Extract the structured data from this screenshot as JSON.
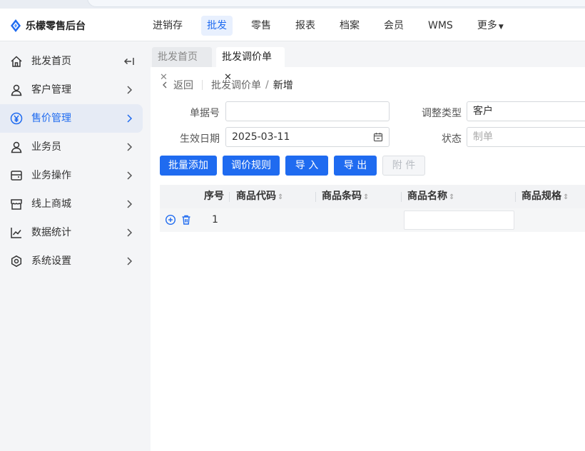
{
  "app": {
    "title": "乐檬零售后台",
    "brand_color": "#1f6bf0"
  },
  "topnav": {
    "items": [
      {
        "label": "进销存",
        "active": false
      },
      {
        "label": "批发",
        "active": true
      },
      {
        "label": "零售",
        "active": false
      },
      {
        "label": "报表",
        "active": false
      },
      {
        "label": "档案",
        "active": false
      },
      {
        "label": "会员",
        "active": false
      },
      {
        "label": "WMS",
        "active": false
      },
      {
        "label": "更多",
        "active": false
      }
    ]
  },
  "sidebar": {
    "items": [
      {
        "label": "批发首页",
        "icon": "home-icon"
      },
      {
        "label": "客户管理",
        "icon": "user-icon"
      },
      {
        "label": "售价管理",
        "icon": "yen-icon",
        "active": true
      },
      {
        "label": "业务员",
        "icon": "user-icon"
      },
      {
        "label": "业务操作",
        "icon": "wallet-icon"
      },
      {
        "label": "线上商城",
        "icon": "store-icon"
      },
      {
        "label": "数据统计",
        "icon": "chart-icon"
      },
      {
        "label": "系统设置",
        "icon": "settings-icon"
      }
    ]
  },
  "tabs": [
    {
      "label": "批发首页",
      "active": false
    },
    {
      "label": "批发调价单",
      "active": true
    }
  ],
  "breadcrumb": {
    "back": "返回",
    "parent": "批发调价单",
    "current": "新增"
  },
  "form": {
    "doc_no_label": "单据号",
    "doc_no_value": "",
    "adjust_type_label": "调整类型",
    "adjust_type_value": "客户",
    "effective_date_label": "生效日期",
    "effective_date_value": "2025-03-11",
    "status_label": "状态",
    "status_placeholder": "制单"
  },
  "toolbar": {
    "batch_add": "批量添加",
    "price_rules": "调价规则",
    "import": "导 入",
    "export": "导 出",
    "attachment": "附 件"
  },
  "table": {
    "columns": [
      "序号",
      "商品代码",
      "商品条码",
      "商品名称",
      "商品规格"
    ],
    "rows": [
      {
        "index": "1"
      }
    ]
  }
}
